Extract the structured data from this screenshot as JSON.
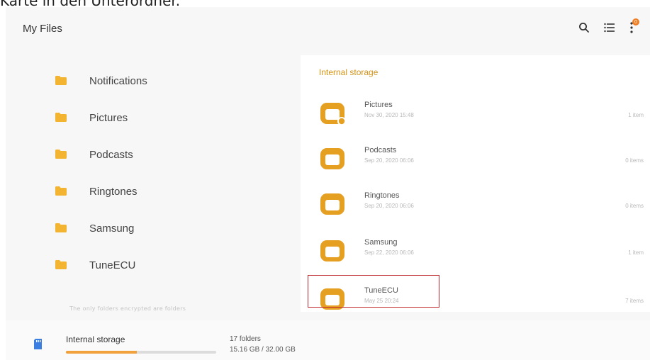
{
  "caption": "Karte in den Unterordner.",
  "header": {
    "title": "My Files",
    "notification_count": "0"
  },
  "folders": [
    {
      "name": "Notifications"
    },
    {
      "name": "Pictures"
    },
    {
      "name": "Podcasts"
    },
    {
      "name": "Ringtones"
    },
    {
      "name": "Samsung"
    },
    {
      "name": "TuneECU"
    }
  ],
  "notice": "The only folders encrypted are folders",
  "panel": {
    "title": "Internal storage",
    "items": [
      {
        "name": "Pictures",
        "date": "Nov 30, 2020 15:48",
        "count": "1 item"
      },
      {
        "name": "Podcasts",
        "date": "Sep 20, 2020 06:06",
        "count": "0 items"
      },
      {
        "name": "Ringtones",
        "date": "Sep 20, 2020 06:06",
        "count": "0 items"
      },
      {
        "name": "Samsung",
        "date": "Sep 22, 2020 06:06",
        "count": "1 item"
      },
      {
        "name": "TuneECU",
        "date": "May 25 20:24",
        "count": "7 items"
      }
    ]
  },
  "storage": {
    "label": "Internal storage",
    "folders": "17 folders",
    "usage": "15.16 GB / 32.00 GB",
    "used_fraction": 0.47
  },
  "colors": {
    "accent": "#f2a03a",
    "folder": "#e6a021",
    "highlight": "#c0272d"
  }
}
